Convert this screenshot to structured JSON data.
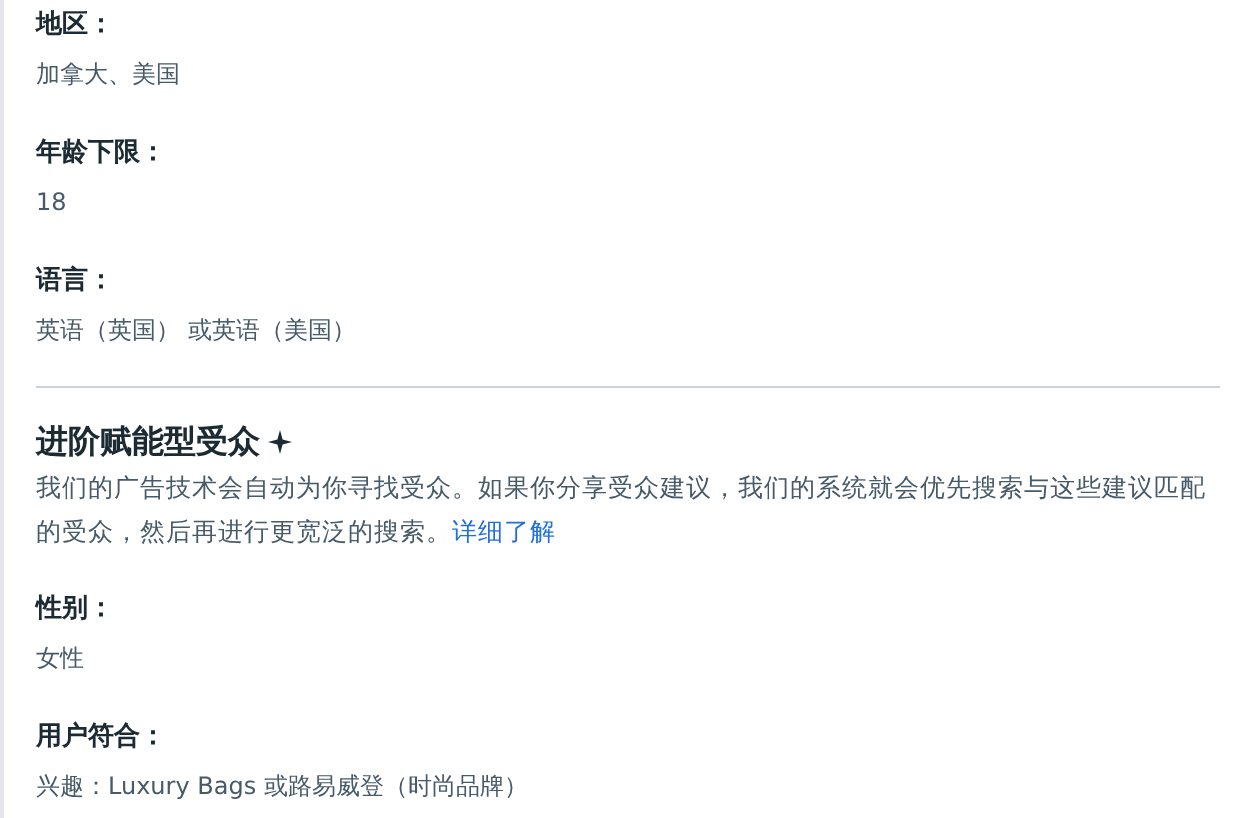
{
  "top_fields": [
    {
      "label": "地区：",
      "value": "加拿大、美国"
    },
    {
      "label": "年龄下限：",
      "value": "18"
    },
    {
      "label": "语言：",
      "value": "英语（英国） 或英语（美国）"
    }
  ],
  "advantage": {
    "title": "进阶赋能型受众",
    "description": "我们的广告技术会自动为你寻找受众。如果你分享受众建议，我们的系统就会优先搜索与这些建议匹配的受众，然后再进行更宽泛的搜索。",
    "link": "详细了解"
  },
  "bottom_fields": [
    {
      "label": "性别：",
      "value": "女性"
    },
    {
      "label": "用户符合：",
      "value": "兴趣：Luxury Bags 或路易威登（时尚品牌）"
    }
  ]
}
